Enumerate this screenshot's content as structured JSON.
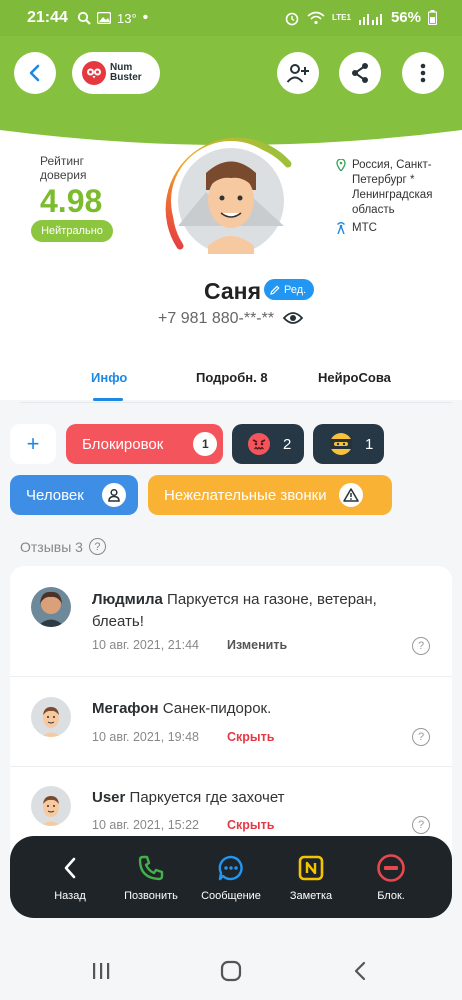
{
  "status_bar": {
    "time": "21:44",
    "temperature": "13°",
    "battery": "56%",
    "network": "LTE1"
  },
  "header": {
    "logo_line1": "Num",
    "logo_line2": "Buster"
  },
  "profile": {
    "rating_label": "Рейтинг доверия",
    "rating_value": "4.98",
    "rating_status": "Нейтрально",
    "location": "Россия, Санкт-Петербург * Ленинградская область",
    "operator": "МТС",
    "name": "Саня",
    "edit_label": "Ред.",
    "phone": "+7 981 880-**-**"
  },
  "tabs": [
    {
      "label": "Инфо",
      "active": true
    },
    {
      "label": "Подробн. 8",
      "active": false
    },
    {
      "label": "НейроСова",
      "active": false
    }
  ],
  "chips": {
    "add": "+",
    "blocks_label": "Блокировок",
    "blocks_count": "1",
    "angry_count": "2",
    "ninja_count": "1",
    "person_label": "Человек",
    "unwanted_label": "Нежелательные звонки"
  },
  "reviews": {
    "title": "Отзывы 3",
    "items": [
      {
        "author": "Людмила",
        "text": "Паркуется на газоне, ветеран, блеать!",
        "date": "10 авг. 2021, 21:44",
        "action": "Изменить",
        "action_color": "#555555",
        "help": "?"
      },
      {
        "author": "Мегафон",
        "text": "Санек-пидорок.",
        "date": "10 авг. 2021, 19:48",
        "action": "Скрыть",
        "action_color": "#e53945",
        "help": "?"
      },
      {
        "author": "User",
        "text": "Паркуется где захочет",
        "date": "10 авг. 2021, 15:22",
        "action": "Скрыть",
        "action_color": "#e53945",
        "help": "?"
      }
    ]
  },
  "actions": [
    {
      "label": "Назад",
      "icon": "chevron-left-icon",
      "color": "#ffffff"
    },
    {
      "label": "Позвонить",
      "icon": "phone-icon",
      "color": "#43b049"
    },
    {
      "label": "Сообщение",
      "icon": "message-icon",
      "color": "#2196f3"
    },
    {
      "label": "Заметка",
      "icon": "note-icon",
      "color": "#f5c400"
    },
    {
      "label": "Блок.",
      "icon": "block-icon",
      "color": "#e5484d"
    }
  ],
  "colors": {
    "header_green": "#86c03f",
    "accent_blue": "#1e88e5",
    "rating_green": "#7cbb2d",
    "blocks_red": "#f4555c",
    "dark_chip": "#263845",
    "person_blue": "#3f8ee6",
    "unwanted_orange": "#f9b233"
  }
}
